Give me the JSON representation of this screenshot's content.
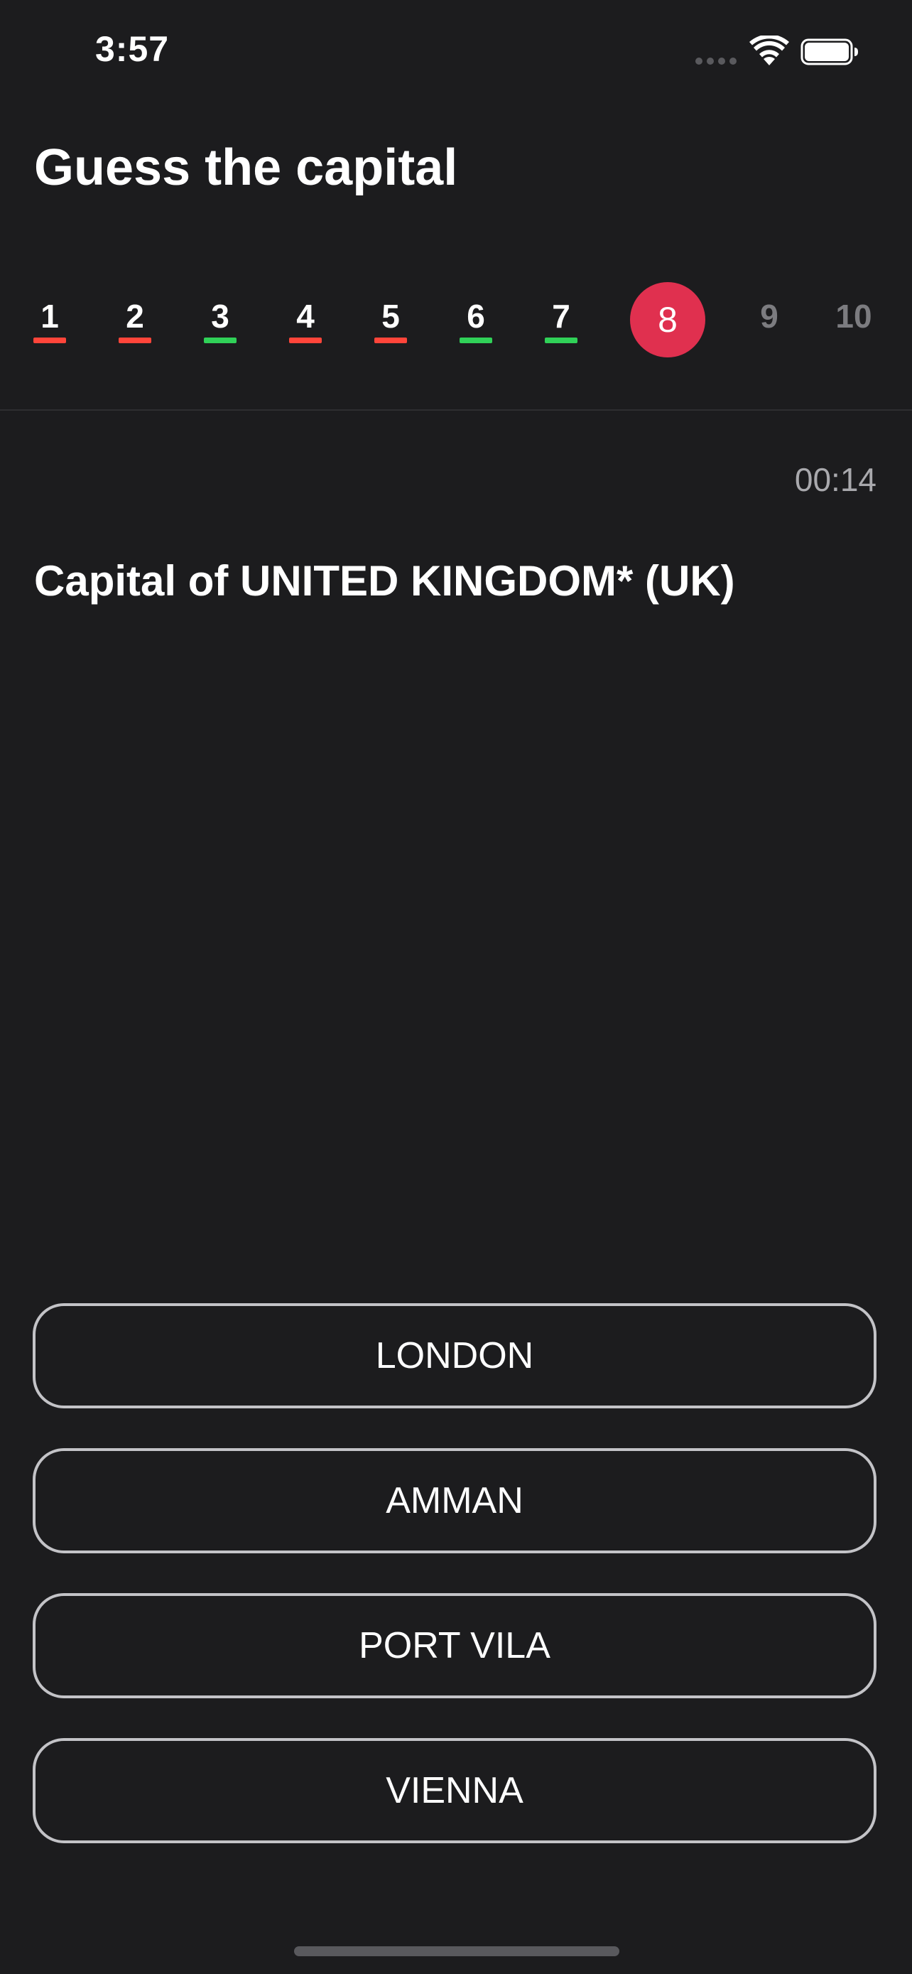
{
  "status_bar": {
    "time": "3:57",
    "icons": [
      "signal-icon",
      "wifi-icon",
      "battery-icon"
    ]
  },
  "title": "Guess the capital",
  "progress": {
    "current": 8,
    "items": [
      {
        "label": "1",
        "state": "wrong",
        "color": "#ff453a"
      },
      {
        "label": "2",
        "state": "wrong",
        "color": "#ff453a"
      },
      {
        "label": "3",
        "state": "correct",
        "color": "#30d158"
      },
      {
        "label": "4",
        "state": "wrong",
        "color": "#ff453a"
      },
      {
        "label": "5",
        "state": "wrong",
        "color": "#ff453a"
      },
      {
        "label": "6",
        "state": "correct",
        "color": "#30d158"
      },
      {
        "label": "7",
        "state": "correct",
        "color": "#30d158"
      },
      {
        "label": "8",
        "state": "current",
        "color": "#e0304f"
      },
      {
        "label": "9",
        "state": "pending",
        "color": "#7c7c80"
      },
      {
        "label": "10",
        "state": "pending",
        "color": "#7c7c80"
      }
    ]
  },
  "timer": "00:14",
  "question": "Capital of UNITED KINGDOM* (UK)",
  "answers": [
    {
      "label": "LONDON"
    },
    {
      "label": "AMMAN"
    },
    {
      "label": "PORT VILA"
    },
    {
      "label": "VIENNA"
    }
  ],
  "colors": {
    "background": "#1c1c1e",
    "accent": "#e0304f",
    "correct": "#30d158",
    "wrong": "#ff453a",
    "button_border": "#c3c3c7"
  }
}
